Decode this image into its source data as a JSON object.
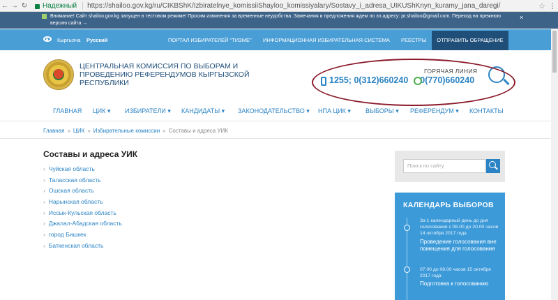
{
  "browser": {
    "secure_label": "Надежный",
    "url": "https://shailoo.gov.kg/ru/CIKBShK/Izbiratelnye_komissiiShayloo_komissiyalary/Sostavy_i_adresa_UIKUShKnyn_kuramy_jana_daregi/"
  },
  "banner": {
    "text": "Внимание! Сайт shailoo.gov.kg запущен в тестовом режиме! Просим извинения за временные неудобства. Замечания и предложения ждем по эл.адресу: pr.shailoo@gmail.com. Переход на прежнюю версию сайта →",
    "close": "×"
  },
  "topnav": {
    "lang_ky": "Кыргызча",
    "lang_ru": "Русский",
    "links": [
      "ПОРТАЛ ИЗБИРАТЕЛЕЙ \"ТИЗМЕ\"",
      "ИНФОРМАЦИОННАЯ ИЗБИРАТЕЛЬНАЯ СИСТЕМА",
      "РЕЕСТРЫ"
    ],
    "appeal": "ОТПРАВИТЬ ОБРАЩЕНИЕ"
  },
  "header": {
    "title": "ЦЕНТРАЛЬНАЯ КОМИССИЯ ПО ВЫБОРАМ И ПРОВЕДЕНИЮ РЕФЕРЕНДУМОВ КЫРГЫЗСКОЙ РЕСПУБЛИКИ",
    "hotline_label": "ГОРЯЧАЯ ЛИНИЯ",
    "hotline_number1": "1255; 0(312)660240",
    "hotline_number2": "0(770)660240"
  },
  "mainnav": [
    "ГЛАВНАЯ",
    "ЦИК ▾",
    "ИЗБИРАТЕЛИ ▾",
    "КАНДИДАТЫ ▾",
    "ЗАКОНОДАТЕЛЬСТВО ▾",
    "НПА ЦИК ▾",
    "ВЫБОРЫ ▾",
    "РЕФЕРЕНДУМ ▾",
    "КОНТАКТЫ"
  ],
  "breadcrumb": {
    "items": [
      "Главная",
      "ЦИК",
      "Избирательные комиссии"
    ],
    "current": "Составы и адреса УИК",
    "separator": "»"
  },
  "content": {
    "title": "Составы и адреса УИК",
    "regions": [
      "Чуйская область",
      "Таласская область",
      "Ошская область",
      "Нарынская область",
      "Иссык-Кульская область",
      "Джалал-Абадская область",
      "город Бишкек",
      "Баткенская область"
    ]
  },
  "sidebar": {
    "search_placeholder": "Поиск по сайту",
    "calendar_title": "КАЛЕНДАРЬ ВЫБОРОВ",
    "events": [
      {
        "date": "За 1 календарный день до дня голосования с 08.00 до 20.00 часов 14 октября 2017 года",
        "event": "Проведение голосования вне помещения для голосования"
      },
      {
        "date": "07.00 до 08.00 часов 15 октября 2017 года",
        "event": "Подготовка к голосованию"
      }
    ]
  },
  "colors": {
    "banner": "#3d6389",
    "topnav": "#4a9ed6",
    "appeal": "#1f4e79",
    "accent": "#2a83c4",
    "calendar": "#3c9ad9",
    "highlight": "#8b1a2b"
  }
}
